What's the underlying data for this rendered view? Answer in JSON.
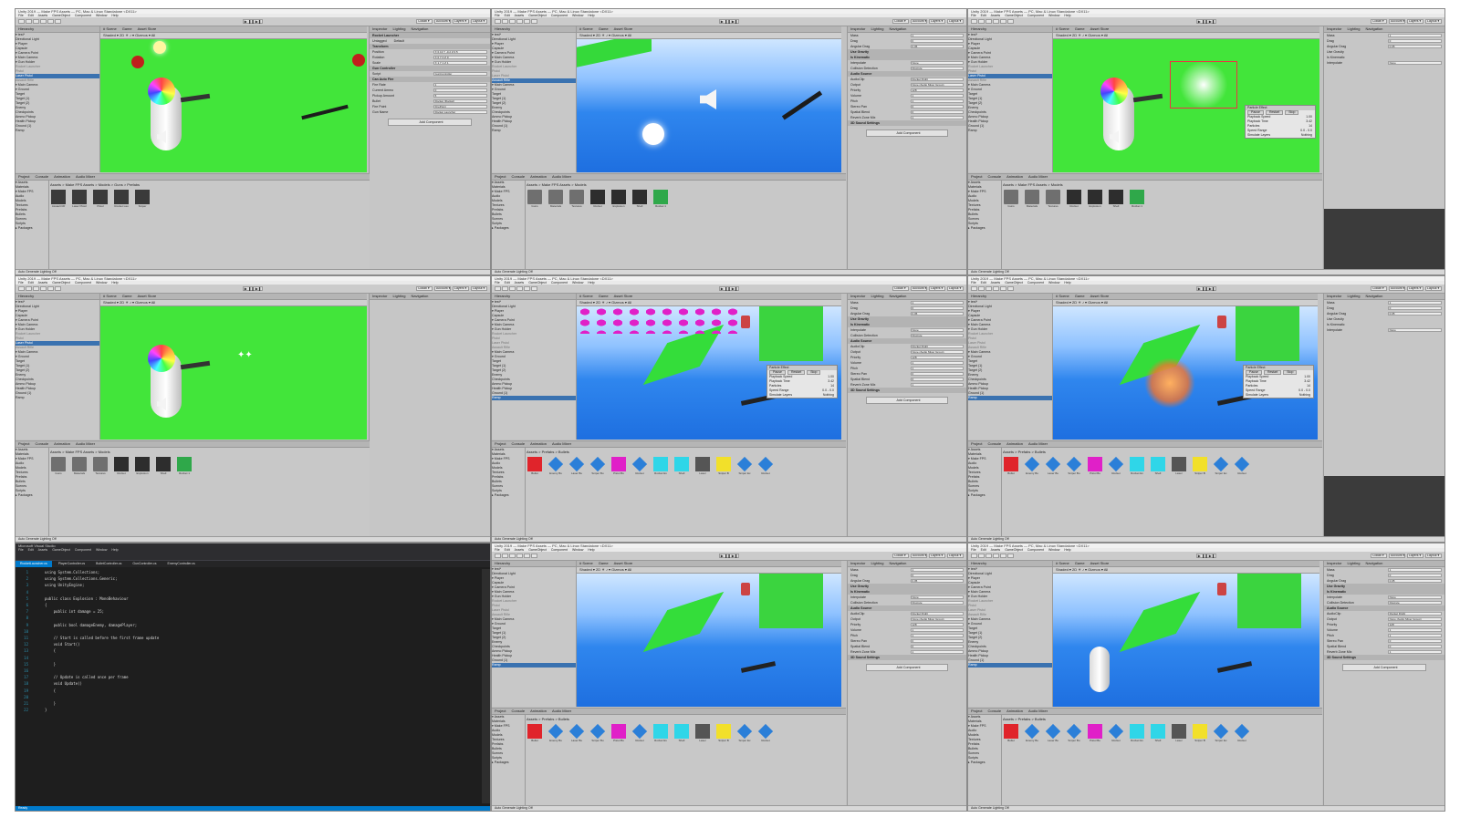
{
  "app": {
    "title": "Unity 2019 — Make FPS Assets — PC, Mac & Linux Standalone <DX11>",
    "menu": [
      "File",
      "Edit",
      "Assets",
      "GameObject",
      "Component",
      "Window",
      "Help"
    ],
    "play_symbols": "▶  ❚❚  ▶❚",
    "toolbar": {
      "collab": "Collab ▾",
      "account": "Account ▾",
      "layers": "Layers ▾",
      "layout": "Layout ▾"
    },
    "tabs": {
      "hierarchy": "Hierarchy",
      "scene": "# Scene",
      "game": "Game",
      "asset_store": "Asset Store",
      "inspector": "Inspector",
      "lighting": "Lighting",
      "navigation": "Navigation",
      "project": "Project",
      "console": "Console",
      "animation": "Animation",
      "audio_mixer": "Audio Mixer"
    },
    "scene_bar": "Shaded  ▾  2D  ☀  ♪  ▾  Gizmos ▾  All",
    "status_text": "Auto Generate Lighting Off"
  },
  "hierarchy_rows": [
    "▾ test*",
    "  Directional Light",
    "  ▾ Player",
    "    Capsule",
    "    ▾ Camera Point",
    "      ▾ Main Camera",
    "        ▾ Gun Holder",
    "          Rocket Launcher",
    "          Pistol",
    "          Laser Pistol",
    "          Assault Rifle",
    "  ▾ Main Camera",
    "  ▾ Ground",
    "  Target",
    "  Target (1)",
    "  Target (2)",
    "  Enemy",
    "  Checkpoints",
    "  Ammo Pickup",
    "  Health Pickup",
    "  Ground (1)",
    "  Ramp"
  ],
  "inspector": {
    "object_name": "Rocket Launcher",
    "tag": "Untagged",
    "layer": "Default",
    "transform": "Transform",
    "rows": [
      {
        "label": "Position",
        "value": "X 0.13   Y -0.2   Z 0.5"
      },
      {
        "label": "Rotation",
        "value": "X 0   Y 0   Z 0"
      },
      {
        "label": "Scale",
        "value": "X 1   Y 1   Z 1"
      },
      {
        "label": "Gun Controller",
        "value": ""
      },
      {
        "label": "Script",
        "value": "GunController"
      },
      {
        "label": "Can Auto Fire",
        "value": ""
      },
      {
        "label": "Fire Rate",
        "value": "1"
      },
      {
        "label": "Current Ammo",
        "value": "0"
      },
      {
        "label": "Pickup Amount",
        "value": "5"
      },
      {
        "label": "Bullet",
        "value": "Rocket (Rocket)"
      },
      {
        "label": "Fire Point",
        "value": "FirePoint"
      },
      {
        "label": "Gun Name",
        "value": "Rocket Launcher"
      }
    ],
    "add_component": "Add Component"
  },
  "rigidbody_panel": {
    "rows": [
      {
        "label": "Mass",
        "value": "1"
      },
      {
        "label": "Drag",
        "value": "0"
      },
      {
        "label": "Angular Drag",
        "value": "0.05"
      },
      {
        "label": "Use Gravity",
        "value": ""
      },
      {
        "label": "Is Kinematic",
        "value": ""
      },
      {
        "label": "Interpolate",
        "value": "None"
      },
      {
        "label": "Collision Detection",
        "value": "Discrete"
      },
      {
        "label": "Audio Source",
        "value": ""
      },
      {
        "label": "AudioClip",
        "value": "Rocket Flight"
      },
      {
        "label": "Output",
        "value": "None (Audio Mixer Group)"
      },
      {
        "label": "Priority",
        "value": "128"
      },
      {
        "label": "Volume",
        "value": "1"
      },
      {
        "label": "Pitch",
        "value": "1"
      },
      {
        "label": "Stereo Pan",
        "value": "0"
      },
      {
        "label": "Spatial Blend",
        "value": "0"
      },
      {
        "label": "Reverb Zone Mix",
        "value": "1"
      },
      {
        "label": "3D Sound Settings",
        "value": ""
      }
    ]
  },
  "project": {
    "path_prefabs": "Assets > Make FPS Assets > Models > Guns > Prefabs",
    "path_models": "Assets > Make FPS Assets > Models",
    "path_bullets": "Assets > Prefabs > Bullets",
    "tree": [
      "▾ Assets",
      "  Materials",
      "  ▾ Make FPS",
      "    Audio",
      "    Models",
      "    Textures",
      "  Prefabs",
      "    Bullets",
      "  Scenes",
      "  Scripts",
      "▸ Packages"
    ],
    "gun_assets": [
      "Assault Rif",
      "Laser Pistol",
      "Pistol",
      "Rocket Lau",
      "Sniper"
    ],
    "model_assets": [
      "Guns",
      "Materials",
      "Textures",
      "Rocket",
      "Explosion",
      "Shell",
      "Rocket 1"
    ],
    "bullet_assets": [
      "Bullet",
      "Enemy Bu",
      "Laser Bu",
      "Sniper Bu",
      "Pistol Bu",
      "Rocket",
      "Rocket Ex",
      "Shell",
      "Laser",
      "Sniper B",
      "Sniper Ex",
      "Rocket"
    ]
  },
  "particle_panel": {
    "title": "Particle Effect",
    "buttons": [
      "Pause",
      "Restart",
      "Stop"
    ],
    "rows": [
      {
        "label": "Playback Speed",
        "value": "1.00"
      },
      {
        "label": "Playback Time",
        "value": "3.42"
      },
      {
        "label": "Particles",
        "value": "14"
      },
      {
        "label": "Speed Range",
        "value": "0.0 - 0.0"
      },
      {
        "label": "Simulate Layers",
        "value": "Nothing"
      }
    ]
  },
  "code": {
    "title": "Microsoft Visual Studio",
    "file_tabs": [
      "RocketLauncher.cs",
      "PlayerController.cs",
      "BulletController.cs",
      "GunController.cs",
      "EnemyController.cs"
    ],
    "lines": [
      {
        "n": "1",
        "t": "using System.Collections;"
      },
      {
        "n": "2",
        "t": "using System.Collections.Generic;"
      },
      {
        "n": "3",
        "t": "using UnityEngine;"
      },
      {
        "n": "4",
        "t": ""
      },
      {
        "n": "5",
        "t": "public class Explosion : MonoBehaviour"
      },
      {
        "n": "6",
        "t": "{"
      },
      {
        "n": "7",
        "t": "    public int damage = 25;"
      },
      {
        "n": "8",
        "t": ""
      },
      {
        "n": "9",
        "t": "    public bool damageEnemy, damagePlayer;"
      },
      {
        "n": "10",
        "t": ""
      },
      {
        "n": "11",
        "t": "    // Start is called before the first frame update"
      },
      {
        "n": "12",
        "t": "    void Start()"
      },
      {
        "n": "13",
        "t": "    {"
      },
      {
        "n": "14",
        "t": ""
      },
      {
        "n": "15",
        "t": "    }"
      },
      {
        "n": "16",
        "t": ""
      },
      {
        "n": "17",
        "t": "    // Update is called once per frame"
      },
      {
        "n": "18",
        "t": "    void Update()"
      },
      {
        "n": "19",
        "t": "    {"
      },
      {
        "n": "20",
        "t": ""
      },
      {
        "n": "21",
        "t": "    }"
      },
      {
        "n": "22",
        "t": "}"
      }
    ],
    "status": "Ready"
  },
  "colors": {
    "unity_bg": "#c2c2c2",
    "green_bg": "#42e53a",
    "selection": "#3a72b0",
    "vs_blue": "#007acc",
    "bullet_red": "#e0242b",
    "bullet_blue": "#2b7fd8",
    "bullet_magenta": "#e020c8",
    "bullet_cyan": "#2fd6e8",
    "bullet_yellow": "#f2e02a"
  }
}
